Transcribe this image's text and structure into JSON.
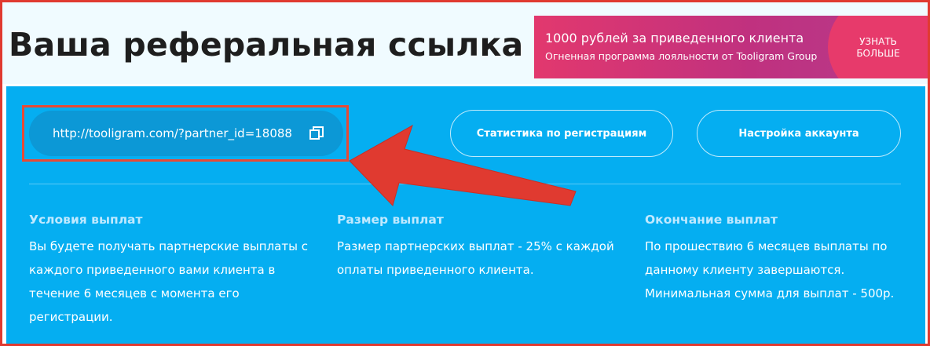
{
  "header": {
    "title": "Ваша реферальная ссылка"
  },
  "promo": {
    "title": "1000 рублей за приведенного клиента",
    "subtitle": "Огненная программа лояльности от Tooligram Group",
    "button_label": "Узнать больше"
  },
  "referral": {
    "link": "http://tooligram.com/?partner_id=18088",
    "copy_icon": "copy-icon"
  },
  "nav": {
    "stats_label": "Статистика по регистрациям",
    "settings_label": "Настройка аккаунта"
  },
  "info": [
    {
      "title": "Условия выплат",
      "text": "Вы будете получать партнерские выплаты с каждого приведенного вами клиента в течение 6 месяцев с момента его регистрации."
    },
    {
      "title": "Размер выплат",
      "text": "Размер партнерских выплат - 25% с каждой оплаты приведенного клиента."
    },
    {
      "title": "Окончание выплат",
      "text": "По прошествию 6 месяцев выплаты по данному клиенту завершаются. Минимальная сумма для выплат - 500р."
    }
  ],
  "colors": {
    "panel": "#05aef1",
    "link_pill": "#0c98d6",
    "promo_gradient_start": "#e2386e",
    "promo_gradient_end": "#b43b8c",
    "annotation_red": "#e03a30"
  }
}
